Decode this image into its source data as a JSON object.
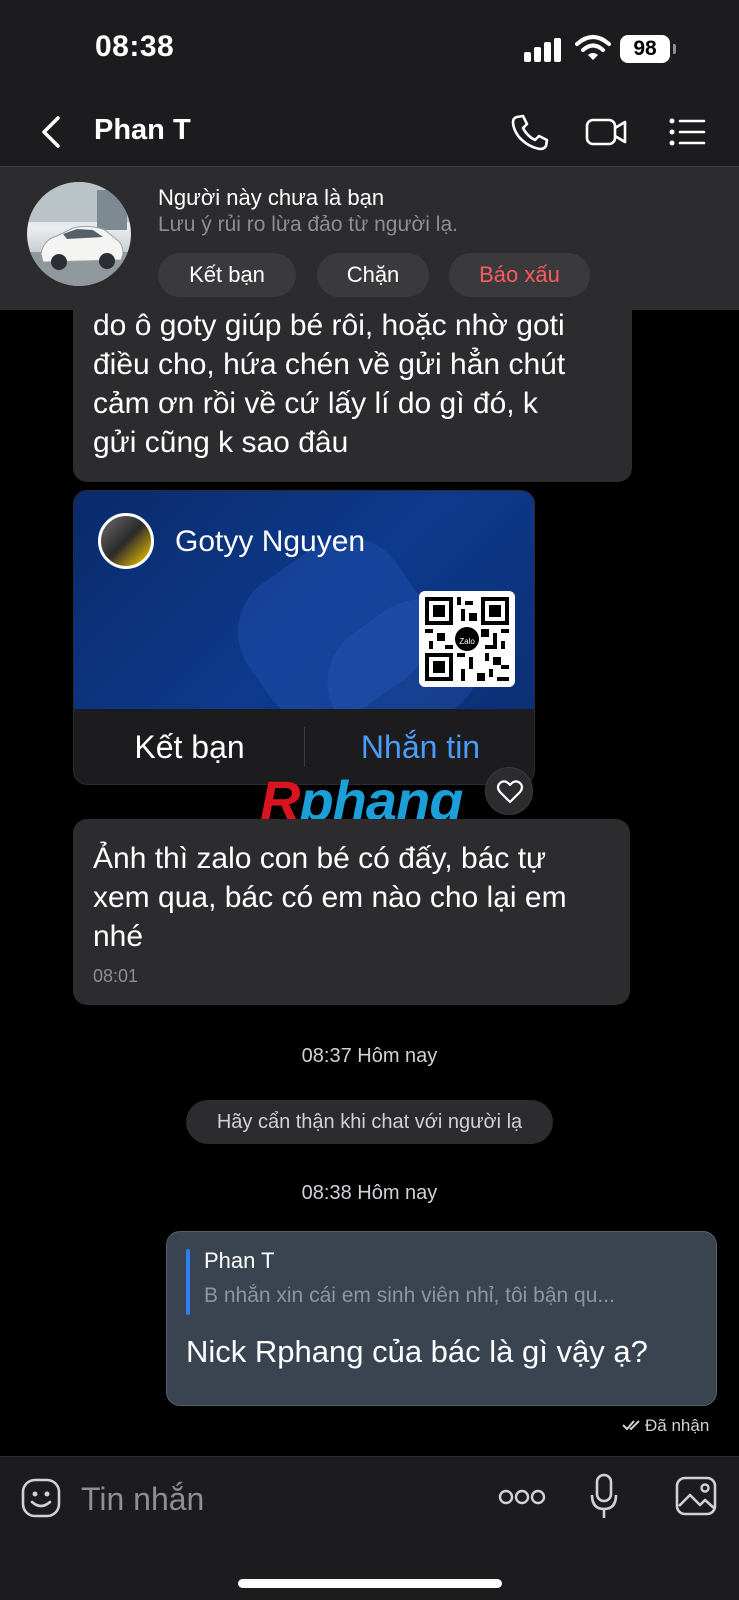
{
  "status": {
    "time": "08:38",
    "battery": "98"
  },
  "header": {
    "title": "Phan T",
    "icons": [
      "back-icon",
      "phone-icon",
      "video-call-icon",
      "menu-list-icon"
    ]
  },
  "stranger": {
    "title": "Người này chưa là bạn",
    "subtitle": "Lưu ý rủi ro lừa đảo từ người lạ.",
    "buttons": {
      "add_friend": "Kết bạn",
      "block": "Chặn",
      "report": "Báo xấu"
    },
    "report_color": "#ff5a5f"
  },
  "messages": [
    {
      "lines": [
        "do ô goty giúp bé rôi, hoặc nhờ goti",
        "điều cho, hứa chén về gửi hẳn chút",
        "cảm ơn rồi về cứ lấy lí do gì đó, k",
        "gửi cũng k sao đâu"
      ]
    },
    {
      "lines": [
        "Ảnh thì zalo con bé có đấy, bác tự",
        "xem qua, bác có em nào cho lại em",
        "nhé"
      ],
      "time": "08:01"
    }
  ],
  "contact_card": {
    "name": "Gotyy Nguyen",
    "qr_logo": "Zalo",
    "add_friend": "Kết bạn",
    "message": "Nhắn tin",
    "message_color": "#4a9df8"
  },
  "watermark": {
    "first": "R",
    "rest": "phang"
  },
  "separators": [
    "08:37 Hôm nay",
    "08:38 Hôm nay"
  ],
  "notice": "Hãy cẩn thận khi chat với người lạ",
  "my_message": {
    "quote_name": "Phan T",
    "quote_text": "B nhắn xin cái em sinh viên nhỉ, tôi bận qu...",
    "text": "Nick Rphang của bác là gì vậy ạ?",
    "status": "Đã nhận"
  },
  "composer": {
    "placeholder": "Tin nhắn",
    "icons": [
      "sticker-icon",
      "more-icon",
      "microphone-icon",
      "image-icon"
    ]
  }
}
